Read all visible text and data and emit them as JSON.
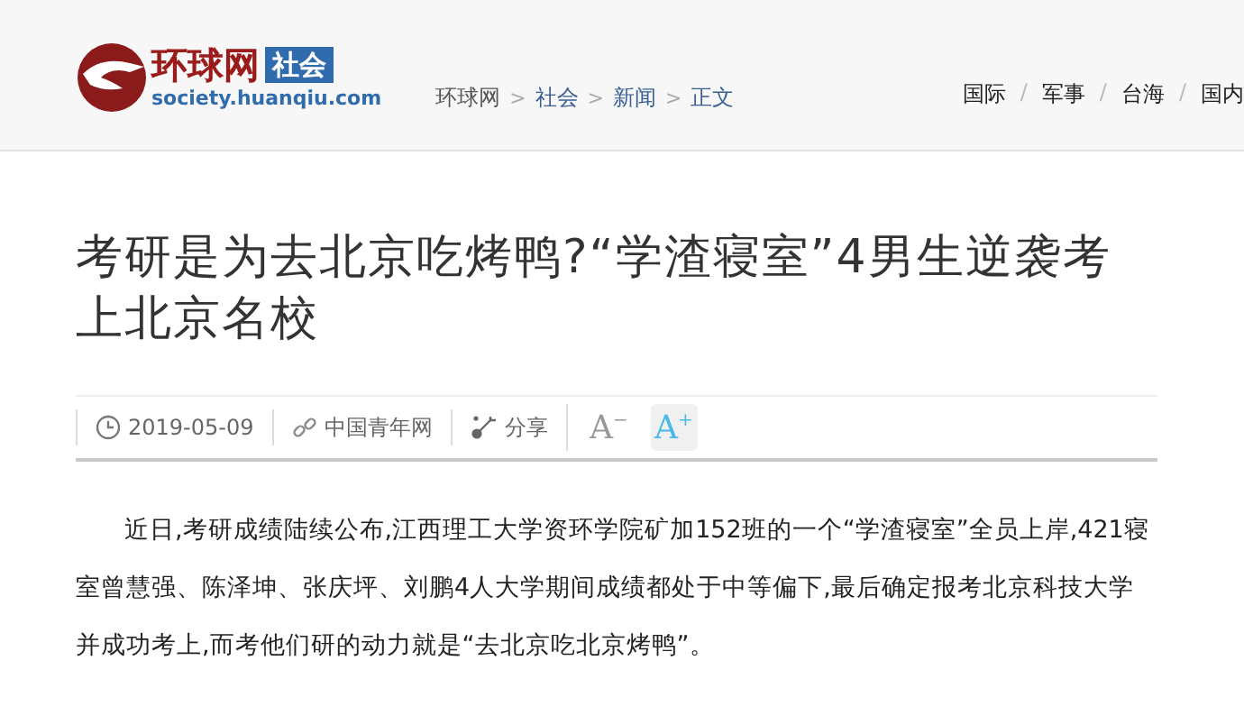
{
  "header": {
    "logo": {
      "brand": "环球网",
      "channel": "社会",
      "domain": "society.huanqiu.com"
    },
    "breadcrumb": [
      {
        "label": "环球网",
        "link": false
      },
      {
        "label": "社会",
        "link": true
      },
      {
        "label": "新闻",
        "link": true
      },
      {
        "label": "正文",
        "link": true
      }
    ],
    "breadcrumb_separator": ">",
    "nav": [
      {
        "label": "国际"
      },
      {
        "label": "军事"
      },
      {
        "label": "台海"
      },
      {
        "label": "国内"
      }
    ],
    "nav_separator": "/"
  },
  "article": {
    "title": "考研是为去北京吃烤鸭?“学渣寝室”4男生逆袭考上北京名校",
    "meta": {
      "date": "2019-05-09",
      "source": "中国青年网",
      "share": "分享",
      "font_buttons": [
        {
          "letter": "A",
          "sign": "−",
          "selected": false
        },
        {
          "letter": "A",
          "sign": "+",
          "selected": true
        }
      ]
    },
    "body": "近日,考研成绩陆续公布,江西理工大学资环学院矿加152班的一个“学渣寝室”全员上岸,421寝室曾慧强、陈泽坤、张庆坪、刘鹏4人大学期间成绩都处于中等偏下,最后确定报考北京科技大学并成功考上,而考他们研的动力就是“去北京吃北京烤鸭”。"
  }
}
